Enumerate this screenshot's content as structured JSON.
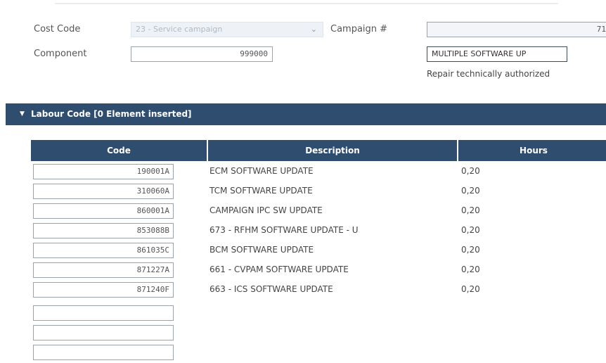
{
  "form": {
    "cost_code_label": "Cost Code",
    "cost_code_value": "23 - Service campaign",
    "campaign_label": "Campaign #",
    "campaign_value": "71",
    "component_label": "Component",
    "component_value": "999000",
    "description_value": "MULTIPLE SOFTWARE UP",
    "repair_note": "Repair technically authorized"
  },
  "section": {
    "title": "Labour Code  [0 Element inserted]"
  },
  "table": {
    "headers": {
      "code": "Code",
      "description": "Description",
      "hours": "Hours"
    },
    "rows": [
      {
        "code": "190001A",
        "description": "ECM SOFTWARE UPDATE",
        "hours": "0,20"
      },
      {
        "code": "310060A",
        "description": "TCM SOFTWARE UPDATE",
        "hours": "0,20"
      },
      {
        "code": "860001A",
        "description": "CAMPAIGN IPC SW UPDATE",
        "hours": "0,20"
      },
      {
        "code": "853088B",
        "description": "673 - RFHM SOFTWARE UPDATE - U",
        "hours": "0,20"
      },
      {
        "code": "861035C",
        "description": "BCM SOFTWARE UPDATE",
        "hours": "0,20"
      },
      {
        "code": "871227A",
        "description": "661 - CVPAM SOFTWARE UPDATE",
        "hours": "0,20"
      },
      {
        "code": "871240F",
        "description": "663 - ICS SOFTWARE UPDATE",
        "hours": "0,20"
      },
      {
        "code": "",
        "description": "",
        "hours": ""
      },
      {
        "code": "",
        "description": "",
        "hours": ""
      },
      {
        "code": "",
        "description": "",
        "hours": ""
      }
    ]
  }
}
